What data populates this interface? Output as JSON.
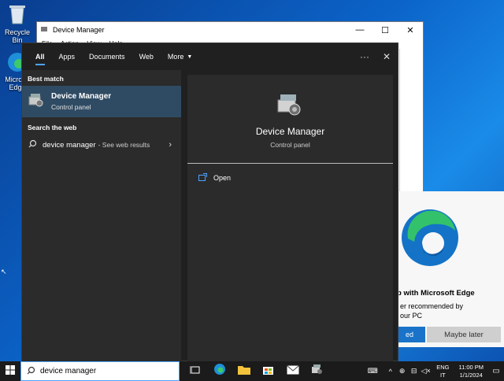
{
  "desktop": {
    "recycle_bin_label": "Recycle Bin",
    "edge_label_line1": "Microso",
    "edge_label_line2": "Edge"
  },
  "bg_window": {
    "title": "Device Manager",
    "controls": [
      "—",
      "☐",
      "✕"
    ],
    "menu": [
      "File",
      "Action",
      "View",
      "Help"
    ]
  },
  "edge_promo": {
    "title": "b with Microsoft Edge",
    "line1": "er recommended by",
    "line2": "our PC",
    "primary_button": "ed",
    "later_button": "Maybe later"
  },
  "search": {
    "tabs": [
      "All",
      "Apps",
      "Documents",
      "Web",
      "More"
    ],
    "more_tools": "···",
    "close": "✕",
    "best_match_heading": "Best match",
    "best_match": {
      "title": "Device Manager",
      "subtitle": "Control panel"
    },
    "web_heading": "Search the web",
    "web_item": {
      "query": "device manager",
      "suffix": "- See web results"
    },
    "preview": {
      "title": "Device Manager",
      "subtitle": "Control panel",
      "open_label": "Open"
    }
  },
  "taskbar": {
    "search_value": "device manager",
    "lang_line1": "ENG",
    "lang_line2": "IT",
    "time": "11:00 PM",
    "date": "1/1/2024"
  },
  "colors": {
    "accent": "#4fa3ff",
    "panel_bg": "#202020",
    "selected_bg": "#2f4b63"
  }
}
